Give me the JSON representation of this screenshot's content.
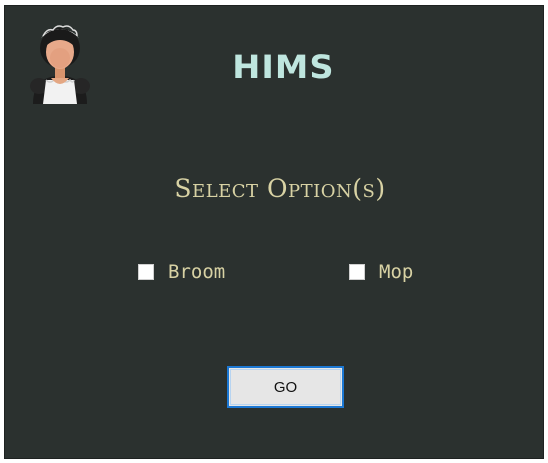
{
  "app": {
    "title": "HIMS"
  },
  "main": {
    "heading": "Select Option(s)",
    "options": [
      {
        "label": "Broom",
        "checked": false
      },
      {
        "label": "Mop",
        "checked": false
      }
    ],
    "go_label": "GO"
  },
  "icons": {
    "avatar": "maid-avatar-icon"
  },
  "colors": {
    "background": "#2b312f",
    "title": "#bfe6df",
    "text": "#d8d2a4",
    "button_border": "#1c78d4"
  }
}
